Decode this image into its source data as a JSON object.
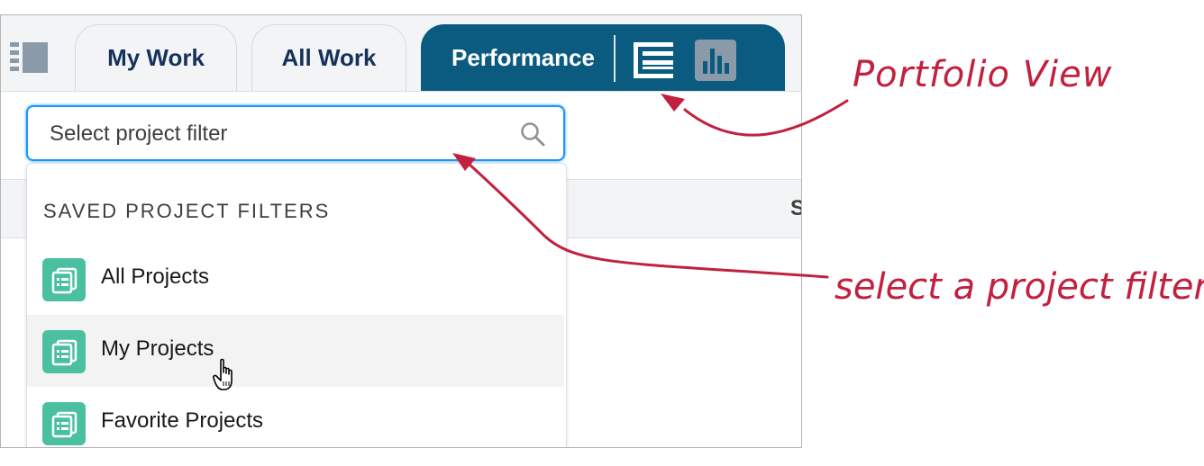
{
  "tabs": {
    "my_work": "My Work",
    "all_work": "All Work",
    "performance": "Performance"
  },
  "search": {
    "placeholder": "Select project filter"
  },
  "dropdown": {
    "heading": "SAVED PROJECT FILTERS",
    "items": [
      {
        "label": "All Projects",
        "icon": "list-icon"
      },
      {
        "label": "My Projects",
        "icon": "list-icon"
      },
      {
        "label": "Favorite Projects",
        "icon": "list-icon"
      }
    ]
  },
  "table": {
    "partial_column_header": "S"
  },
  "annotations": {
    "portfolio_view": "Portfolio View",
    "select_filter": "select a project filter"
  },
  "colors": {
    "active_tab": "#0a5b7f",
    "tab_text": "#16325c",
    "focus_border": "#1b96ff",
    "item_icon": "#4bc0a1",
    "annotation": "#c2203f"
  }
}
